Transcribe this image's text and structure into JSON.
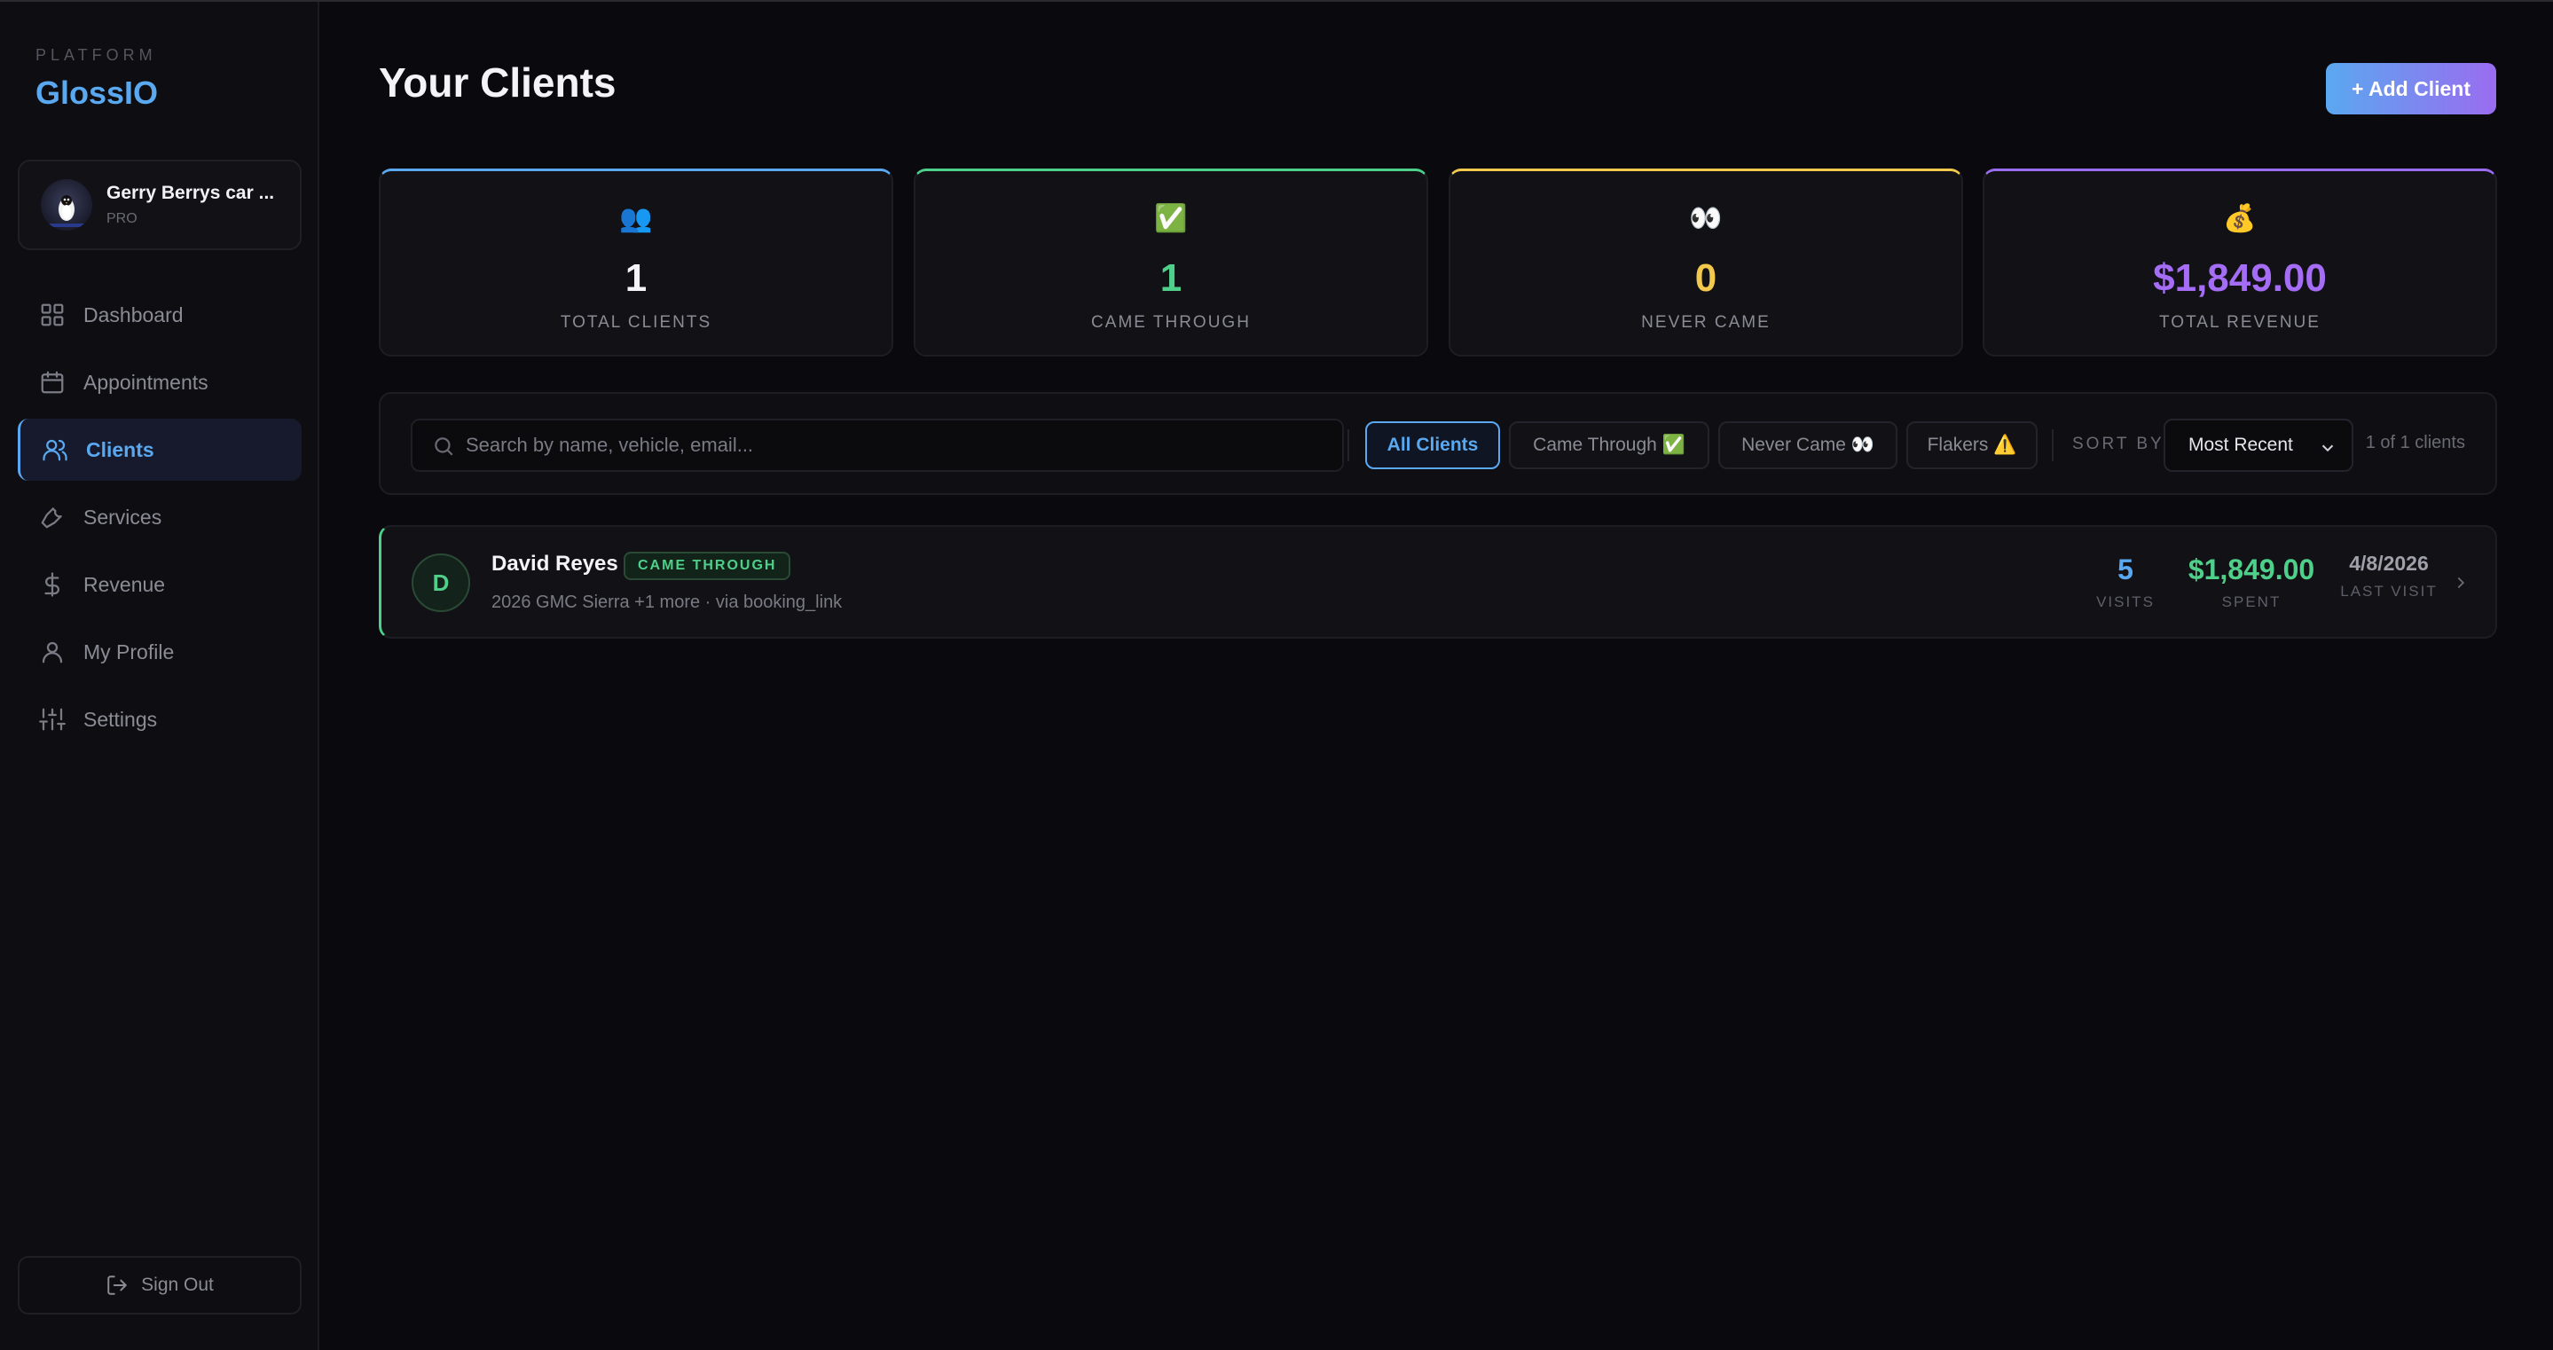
{
  "sidebar": {
    "platform_label": "PLATFORM",
    "brand": "GlossIO",
    "account": {
      "name": "Gerry Berrys car ...",
      "plan": "PRO"
    },
    "items": [
      {
        "label": "Dashboard",
        "icon": "grid-icon"
      },
      {
        "label": "Appointments",
        "icon": "calendar-icon"
      },
      {
        "label": "Clients",
        "icon": "users-icon",
        "active": true
      },
      {
        "label": "Services",
        "icon": "wrench-icon"
      },
      {
        "label": "Revenue",
        "icon": "dollar-icon"
      },
      {
        "label": "My Profile",
        "icon": "user-icon"
      },
      {
        "label": "Settings",
        "icon": "sliders-icon"
      }
    ],
    "sign_out": "Sign Out"
  },
  "header": {
    "title": "Your Clients",
    "add_button": "+ Add Client"
  },
  "stats": [
    {
      "emoji": "👥",
      "value": "1",
      "label": "TOTAL CLIENTS",
      "accent": "#5aa8f0",
      "value_color": "#f4f4f7"
    },
    {
      "emoji": "✅",
      "value": "1",
      "label": "CAME THROUGH",
      "accent": "#4fd08a",
      "value_color": "#4fd08a"
    },
    {
      "emoji": "👀",
      "value": "0",
      "label": "NEVER CAME",
      "accent": "#f2c94c",
      "value_color": "#f2c94c"
    },
    {
      "emoji": "💰",
      "value": "$1,849.00",
      "label": "TOTAL REVENUE",
      "accent": "#9a6cf0",
      "value_color": "#a56cf5"
    }
  ],
  "filters": {
    "search_placeholder": "Search by name, vehicle, email...",
    "chips": [
      {
        "label": "All Clients",
        "active": true
      },
      {
        "label": "Came Through ✅"
      },
      {
        "label": "Never Came 👀"
      },
      {
        "label": "Flakers ⚠️"
      }
    ],
    "sort_label": "SORT BY",
    "sort_value": "Most Recent",
    "count_text": "1 of 1 clients"
  },
  "clients": [
    {
      "initial": "D",
      "name": "David Reyes",
      "badge": "CAME THROUGH",
      "meta": "2026 GMC Sierra +1 more · via booking_link",
      "visits": "5",
      "visits_label": "VISITS",
      "spent": "$1,849.00",
      "spent_label": "SPENT",
      "last_visit": "4/8/2026",
      "last_visit_label": "LAST VISIT"
    }
  ],
  "colors": {
    "accent_blue": "#5aa8f0",
    "accent_green": "#4fd08a",
    "accent_yellow": "#f2c94c",
    "accent_purple": "#9a6cf0"
  }
}
